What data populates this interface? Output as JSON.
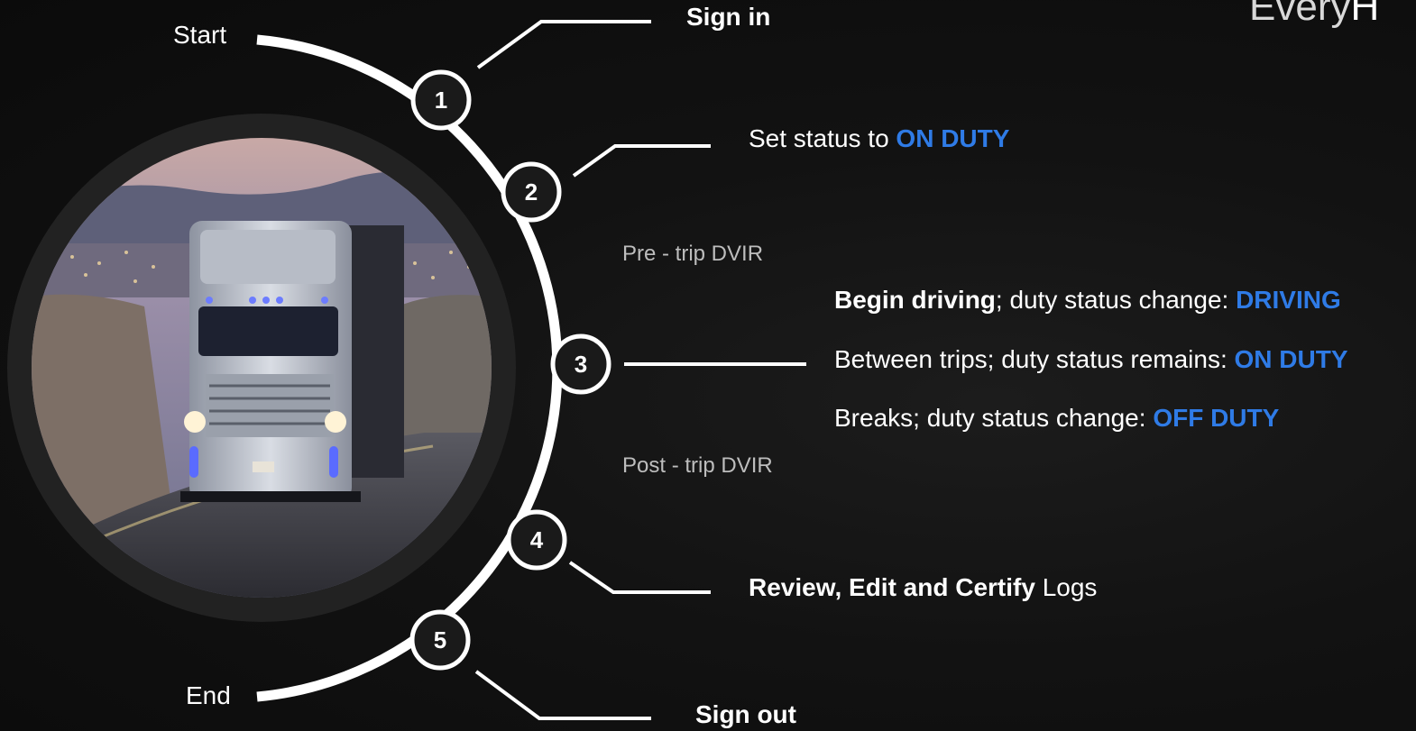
{
  "corner_title": {
    "light": "Every",
    "bold": "H"
  },
  "labels": {
    "start": "Start",
    "end": "End"
  },
  "nodes": [
    "1",
    "2",
    "3",
    "4",
    "5"
  ],
  "steps": {
    "sign_in": "Sign in",
    "set_status": {
      "text": "Set status to ",
      "accent": "ON DUTY"
    },
    "pre_trip": "Pre - trip DVIR",
    "begin_driving": {
      "bold": "Begin driving",
      "text": "; duty status change: ",
      "accent": "DRIVING"
    },
    "between_trips": {
      "text": "Between trips; duty status remains: ",
      "accent": "ON DUTY"
    },
    "breaks": {
      "text": "Breaks; duty status change: ",
      "accent": "OFF DUTY"
    },
    "post_trip": "Post - trip DVIR",
    "review": {
      "bold": "Review, Edit and Certify",
      "text": " Logs"
    },
    "sign_out": "Sign out"
  },
  "colors": {
    "accent": "#2f7be6",
    "line": "#ffffff",
    "node_fill": "#1a1a1a",
    "ring": "#262626"
  }
}
